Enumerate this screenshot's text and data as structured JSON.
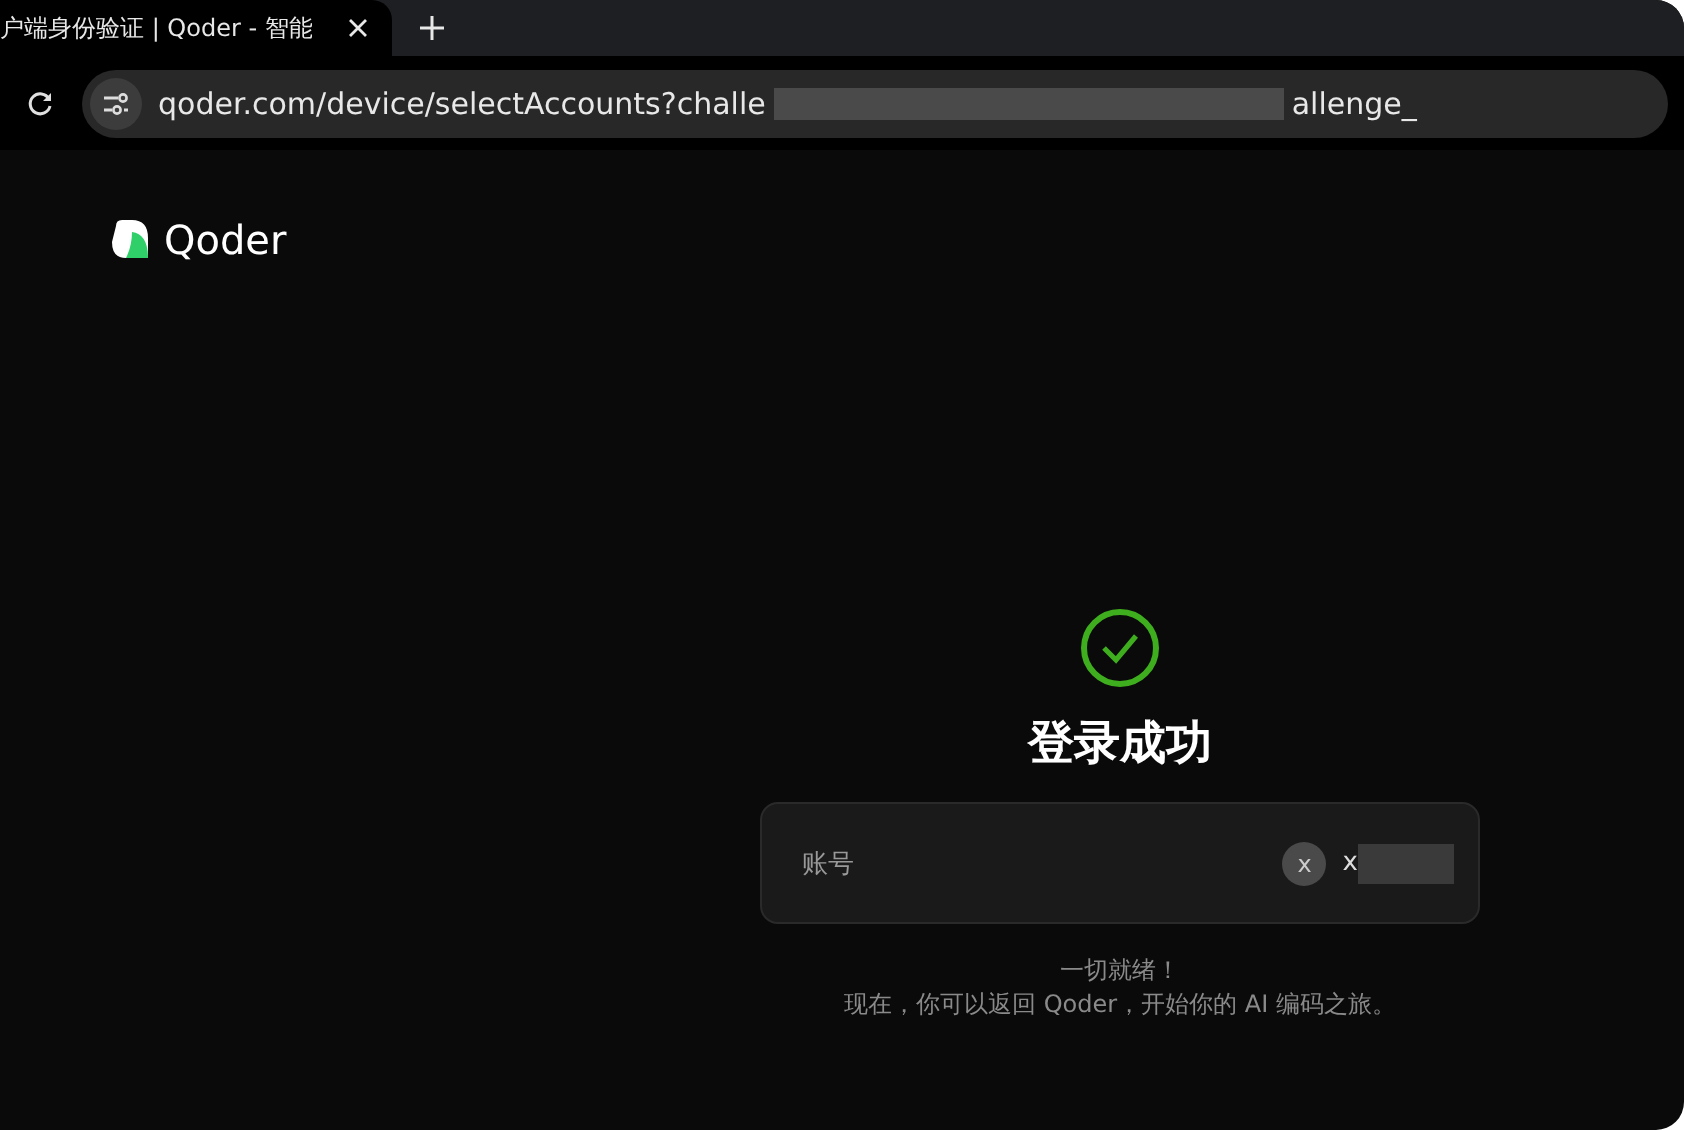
{
  "browser": {
    "tab": {
      "title": "户端身份验证 | Qoder - 智能",
      "selected": true
    },
    "address": {
      "url": "qoder.com/device/selectAccounts?challe",
      "url_tail": "allenge_"
    }
  },
  "brand": {
    "name": "Qoder"
  },
  "status": {
    "title": "登录成功"
  },
  "account": {
    "label": "账号",
    "avatar": "x",
    "name": "x"
  },
  "message": {
    "lines": [
      "一切就绪！",
      "现在，你可以返回 Qoder，开始你的 AI 编码之旅。"
    ]
  }
}
